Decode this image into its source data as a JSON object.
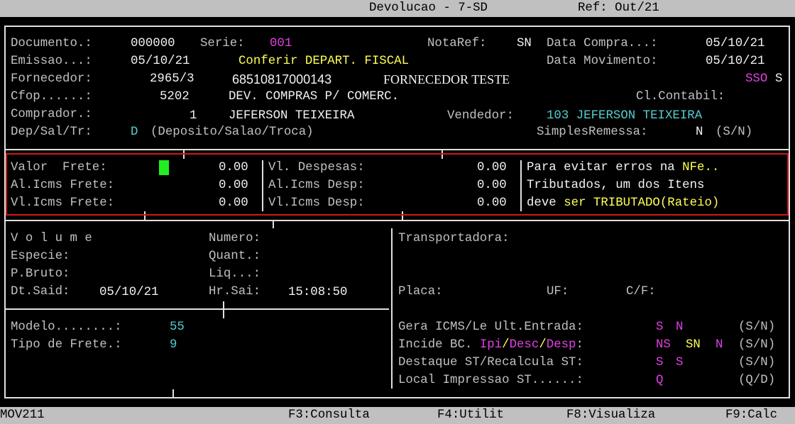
{
  "header": {
    "title": "Devolucao - 7-SD",
    "ref": "Ref: Out/21"
  },
  "doc": {
    "documento_label": "Documento.:",
    "documento_value": "000000",
    "serie_label": "Serie:",
    "serie_value": "001",
    "notaref_label": "NotaRef:",
    "notaref_value": "SN",
    "data_compra_label": "Data Compra...:",
    "data_compra_value": "05/10/21",
    "emissao_label": "Emissao...:",
    "emissao_value": "05/10/21",
    "conferir_msg": "Conferir DEPART. FISCAL",
    "data_mov_label": "Data Movimento:",
    "data_mov_value": "05/10/21",
    "fornecedor_label": "Fornecedor:",
    "fornecedor_code": "2965/3",
    "fornecedor_cnpj": "68510817000143",
    "fornecedor_name": "FORNECEDOR TESTE",
    "sso_flags": "SSO",
    "sso_last": "S",
    "cfop_label": "Cfop......:",
    "cfop_value": "5202",
    "cfop_desc": "DEV. COMPRAS P/ COMERC.",
    "clcontabil_label": "Cl.Contabil:",
    "comprador_label": "Comprador.:",
    "comprador_code": "1",
    "comprador_name": "JEFERSON TEIXEIRA",
    "vendedor_label": "Vendedor:",
    "vendedor_value": "103 JEFERSON TEIXEIRA",
    "dep_label": "Dep/Sal/Tr:",
    "dep_value": "D",
    "dep_desc": "(Deposito/Salao/Troca)",
    "simples_label": "SimplesRemessa:",
    "simples_value": "N",
    "simples_opts": "(S/N)"
  },
  "freight": {
    "valor_frete_label": "Valor  Frete:",
    "valor_frete_value": "0.00",
    "al_icms_frete_label": "Al.Icms Frete:",
    "al_icms_frete_value": "0.00",
    "vl_icms_frete_label": "Vl.Icms Frete:",
    "vl_icms_frete_value": "0.00",
    "vl_despesas_label": "Vl. Despesas:",
    "vl_despesas_value": "0.00",
    "al_icms_desp_label": "Al.Icms Desp:",
    "al_icms_desp_value": "0.00",
    "vl_icms_desp_label": "Vl.Icms Desp:",
    "vl_icms_desp_value": "0.00",
    "msg1_a": "Para evitar erros na ",
    "msg1_b": "NFe..",
    "msg2": "Tributados, um dos Itens",
    "msg3_a": "deve ",
    "msg3_b": "ser TRIBUTADO(Rateio)"
  },
  "volume": {
    "volume_label": "V o l u m e",
    "numero_label": "Numero:",
    "especie_label": "Especie:",
    "quant_label": "Quant.:",
    "pbruto_label": "P.Bruto:",
    "liq_label": "Liq...:",
    "dtsaid_label": "Dt.Said:",
    "dtsaid_value": "05/10/21",
    "hrsai_label": "Hr.Sai:",
    "hrsai_value": "15:08:50"
  },
  "transport": {
    "transportadora_label": "Transportadora:",
    "placa_label": "Placa:",
    "uf_label": "UF:",
    "cf_label": "C/F:"
  },
  "modelo": {
    "modelo_label": "Modelo........:",
    "modelo_value": "55",
    "tipo_frete_label": "Tipo de Frete.:",
    "tipo_frete_value": "9"
  },
  "fiscal": {
    "gera_label": "Gera ICMS/Le Ult.Entrada:",
    "gera_v1": "S",
    "gera_v2": "N",
    "gera_opts": "(S/N)",
    "incide_label": "Incide BC.",
    "incide_ipi": "Ipi",
    "slash1": "/",
    "incide_desc": "Desc",
    "slash2": "/",
    "incide_desp": "Desp",
    "incide_colon": ":",
    "incide_v1": "NS",
    "incide_v2": "SN",
    "incide_v3": "N",
    "incide_opts": "(S/N)",
    "destaque_label": "Destaque ST/Recalcula ST:",
    "destaque_v1": "S",
    "destaque_v2": "S",
    "destaque_opts": "(S/N)",
    "local_label": "Local Impressao ST......:",
    "local_value": "Q",
    "local_opts": "(Q/D)"
  },
  "footer": {
    "program": "MOV211",
    "f3": "F3:Consulta",
    "f4": "F4:Utilit",
    "f8": "F8:Visualiza",
    "f9": "F9:Calc"
  },
  "colors": {
    "background": "#000000",
    "text": "#c0c0c0",
    "highlight_yellow": "#ffff55",
    "cyan": "#55cccc",
    "magenta": "#e040e0",
    "alert_border": "#d01818",
    "cursor": "#22ee22"
  }
}
